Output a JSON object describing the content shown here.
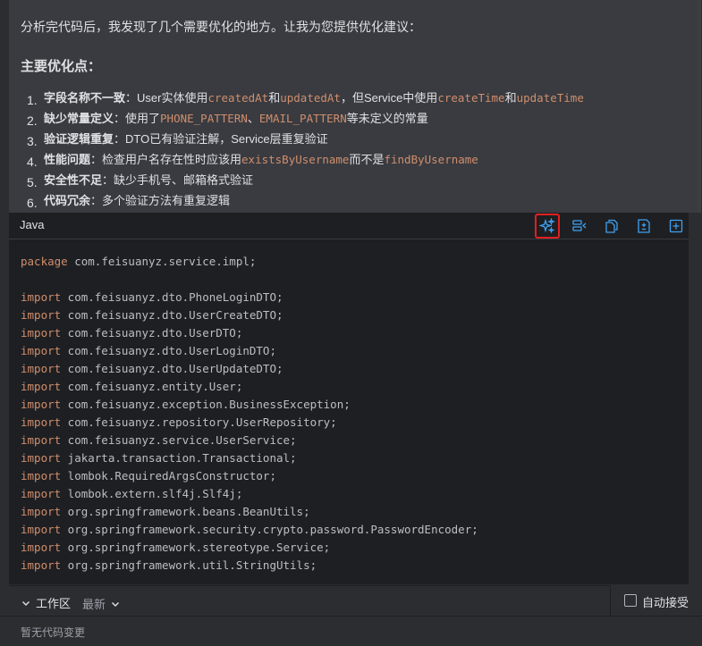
{
  "chat": {
    "intro": "分析完代码后，我发现了几个需要优化的地方。让我为您提供优化建议：",
    "heading": "主要优化点：",
    "points": [
      {
        "num": "1.",
        "segments": [
          {
            "t": "字段名称不一致",
            "style": "bold"
          },
          {
            "t": "：User实体使用",
            "style": "text"
          },
          {
            "t": "createdAt",
            "style": "code"
          },
          {
            "t": "和",
            "style": "text"
          },
          {
            "t": "updatedAt",
            "style": "code"
          },
          {
            "t": "，但Service中使用",
            "style": "text"
          },
          {
            "t": "createTime",
            "style": "code"
          },
          {
            "t": "和",
            "style": "text"
          },
          {
            "t": "updateTime",
            "style": "code"
          }
        ]
      },
      {
        "num": "2.",
        "segments": [
          {
            "t": "缺少常量定义",
            "style": "bold"
          },
          {
            "t": "：使用了",
            "style": "text"
          },
          {
            "t": "PHONE_PATTERN",
            "style": "code"
          },
          {
            "t": "、",
            "style": "text"
          },
          {
            "t": "EMAIL_PATTERN",
            "style": "code"
          },
          {
            "t": "等未定义的常量",
            "style": "text"
          }
        ]
      },
      {
        "num": "3.",
        "segments": [
          {
            "t": "验证逻辑重复",
            "style": "bold"
          },
          {
            "t": "：DTO已有验证注解，Service层重复验证",
            "style": "text"
          }
        ]
      },
      {
        "num": "4.",
        "segments": [
          {
            "t": "性能问题",
            "style": "bold"
          },
          {
            "t": "：检查用户名存在性时应该用",
            "style": "text"
          },
          {
            "t": "existsByUsername",
            "style": "code"
          },
          {
            "t": "而不是",
            "style": "text"
          },
          {
            "t": "findByUsername",
            "style": "code"
          }
        ]
      },
      {
        "num": "5.",
        "segments": [
          {
            "t": "安全性不足",
            "style": "bold"
          },
          {
            "t": "：缺少手机号、邮箱格式验证",
            "style": "text"
          }
        ]
      },
      {
        "num": "6.",
        "segments": [
          {
            "t": "代码冗余",
            "style": "bold"
          },
          {
            "t": "：多个验证方法有重复逻辑",
            "style": "text"
          }
        ]
      }
    ]
  },
  "code_block": {
    "language": "Java",
    "toolbar": [
      {
        "name": "ai-sparkle-icon",
        "selected": true
      },
      {
        "name": "insert-at-caret-icon",
        "selected": false
      },
      {
        "name": "copy-icon",
        "selected": false
      },
      {
        "name": "diff-icon",
        "selected": false
      },
      {
        "name": "new-file-icon",
        "selected": false
      }
    ],
    "lines": [
      {
        "kw": "package",
        "rest": " com.feisuanyz.service.impl;"
      },
      {
        "kw": "",
        "rest": ""
      },
      {
        "kw": "import",
        "rest": " com.feisuanyz.dto.PhoneLoginDTO;"
      },
      {
        "kw": "import",
        "rest": " com.feisuanyz.dto.UserCreateDTO;"
      },
      {
        "kw": "import",
        "rest": " com.feisuanyz.dto.UserDTO;"
      },
      {
        "kw": "import",
        "rest": " com.feisuanyz.dto.UserLoginDTO;"
      },
      {
        "kw": "import",
        "rest": " com.feisuanyz.dto.UserUpdateDTO;"
      },
      {
        "kw": "import",
        "rest": " com.feisuanyz.entity.User;"
      },
      {
        "kw": "import",
        "rest": " com.feisuanyz.exception.BusinessException;"
      },
      {
        "kw": "import",
        "rest": " com.feisuanyz.repository.UserRepository;"
      },
      {
        "kw": "import",
        "rest": " com.feisuanyz.service.UserService;"
      },
      {
        "kw": "import",
        "rest": " jakarta.transaction.Transactional;"
      },
      {
        "kw": "import",
        "rest": " lombok.RequiredArgsConstructor;"
      },
      {
        "kw": "import",
        "rest": " lombok.extern.slf4j.Slf4j;"
      },
      {
        "kw": "import",
        "rest": " org.springframework.beans.BeanUtils;"
      },
      {
        "kw": "import",
        "rest": " org.springframework.security.crypto.password.PasswordEncoder;"
      },
      {
        "kw": "import",
        "rest": " org.springframework.stereotype.Service;"
      },
      {
        "kw": "import",
        "rest": " org.springframework.util.StringUtils;"
      }
    ]
  },
  "workspace": {
    "title": "工作区",
    "filter": "最新",
    "auto_accept_label": "自动接受",
    "auto_accept_checked": false,
    "status": "暂无代码变更"
  }
}
